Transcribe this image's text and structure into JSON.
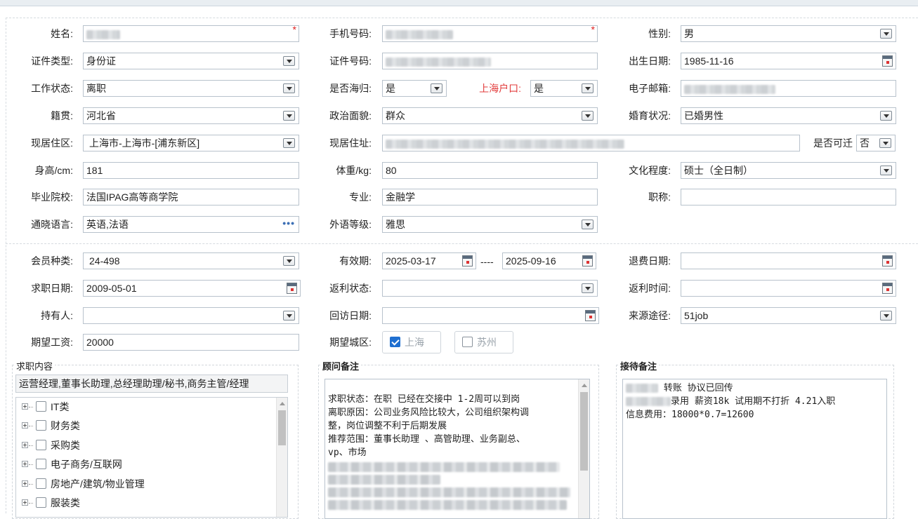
{
  "form": {
    "name_label": "姓名:",
    "phone_label": "手机号码:",
    "gender_label": "性别:",
    "gender_value": "男",
    "idtype_label": "证件类型:",
    "idtype_value": "身份证",
    "idno_label": "证件号码:",
    "birth_label": "出生日期:",
    "birth_value": "1985-11-16",
    "workstatus_label": "工作状态:",
    "workstatus_value": "离职",
    "returnee_label": "是否海归:",
    "returnee_value": "是",
    "hukou_label": "上海户口:",
    "hukou_value": "是",
    "email_label": "电子邮箱:",
    "native_label": "籍贯:",
    "native_value": "河北省",
    "political_label": "政治面貌:",
    "political_value": "群众",
    "marital_label": "婚育状况:",
    "marital_value": "已婚男性",
    "district_label": "现居住区:",
    "district_value": "上海市-上海市-[浦东新区]",
    "address_label": "现居住址:",
    "relocate_label": "是否可迁",
    "relocate_value": "否",
    "height_label": "身高/cm:",
    "height_value": "181",
    "weight_label": "体重/kg:",
    "weight_value": "80",
    "education_label": "文化程度:",
    "education_value": "硕士（全日制）",
    "school_label": "毕业院校:",
    "school_value": "法国IPAG高等商学院",
    "major_label": "专业:",
    "major_value": "金融学",
    "title_label": "职称:",
    "title_value": "",
    "languages_label": "通晓语言:",
    "languages_value": "英语,法语",
    "langlevel_label": "外语等级:",
    "langlevel_value": "雅思"
  },
  "member": {
    "type_label": "会员种类:",
    "type_value": "24-498",
    "validity_label": "有效期:",
    "valid_from": "2025-03-17",
    "valid_sep": "----",
    "valid_to": "2025-09-16",
    "refund_date_label": "退费日期:",
    "jobdate_label": "求职日期:",
    "jobdate_value": "2009-05-01",
    "rebate_status_label": "返利状态:",
    "rebate_time_label": "返利时间:",
    "holder_label": "持有人:",
    "visit_label": "回访日期:",
    "source_label": "来源途径:",
    "source_value": "51job",
    "salary_label": "期望工资:",
    "salary_value": "20000",
    "city_label": "期望城区:",
    "city_opt1": "上海",
    "city_opt2": "苏州"
  },
  "job_panel": {
    "title": "求职内容",
    "selected": "运营经理,董事长助理,总经理助理/秘书,商务主管/经理",
    "tree": [
      "IT类",
      "财务类",
      "采购类",
      "电子商务/互联网",
      "房地产/建筑/物业管理",
      "服装类"
    ]
  },
  "advisor_panel": {
    "title": "顾问备注",
    "lines": [
      "求职状态：在职  已经在交接中 1-2周可以到岗",
      "离职原因：公司业务风险比较大，公司组织架构调",
      "整，岗位调整不利于后期发展",
      "推荐范围：董事长助理 、高管助理、业务副总、",
      "vp、市场"
    ]
  },
  "reception_panel": {
    "title": "接待备注",
    "line1": "转账 协议已回传",
    "line2": "录用 薪资18k 试用期不打折 4.21入职",
    "line3": "信息费用：18000*0.7=12600"
  }
}
